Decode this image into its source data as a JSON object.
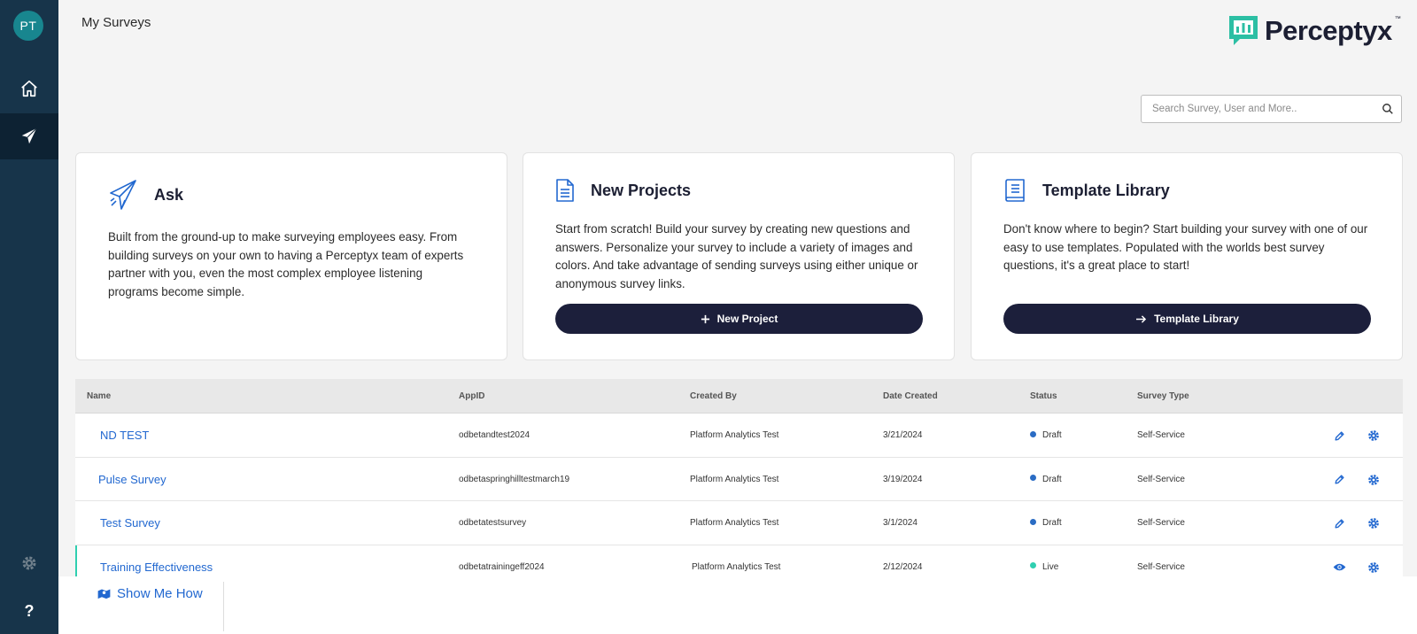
{
  "sidebar": {
    "avatar_initials": "PT",
    "items": [
      {
        "icon": "home-icon"
      },
      {
        "icon": "paper-plane-icon",
        "active": true
      },
      {
        "icon": "gear-icon"
      },
      {
        "icon": "help-icon",
        "label": "?"
      }
    ]
  },
  "header": {
    "title": "My Surveys",
    "logo_text": "Perceptyx",
    "logo_tm": "™"
  },
  "search": {
    "placeholder": "Search Survey, User and More.."
  },
  "cards": {
    "ask": {
      "title": "Ask",
      "body": "Built from the ground-up to make surveying employees easy. From building surveys on your own to having a Perceptyx team of experts partner with you, even the most complex employee listening programs become simple."
    },
    "projects": {
      "title": "New Projects",
      "body": "Start from scratch! Build your survey by creating new questions and answers. Personalize your survey to include a variety of images and colors. And take advantage of sending surveys using either unique or anonymous survey links.",
      "button": "New Project"
    },
    "template": {
      "title": "Template Library",
      "body": "Don't know where to begin? Start building your survey with one of our easy to use templates. Populated with the worlds best survey questions, it's a great place to start!",
      "button": "Template Library"
    }
  },
  "table": {
    "columns": {
      "name": "Name",
      "appid": "AppID",
      "created_by": "Created By",
      "date_created": "Date Created",
      "status": "Status",
      "survey_type": "Survey Type"
    },
    "rows": [
      {
        "name": "ND TEST",
        "appid": "odbetandtest2024",
        "created_by": "Platform Analytics Test",
        "date": "3/21/2024",
        "status": "Draft",
        "type": "Self-Service"
      },
      {
        "name": "Pulse Survey",
        "appid": "odbetaspringhilltestmarch19",
        "created_by": "Platform Analytics Test",
        "date": "3/19/2024",
        "status": "Draft",
        "type": "Self-Service"
      },
      {
        "name": "Test Survey",
        "appid": "odbetatestsurvey",
        "created_by": "Platform Analytics Test",
        "date": "3/1/2024",
        "status": "Draft",
        "type": "Self-Service"
      },
      {
        "name": "Training Effectiveness",
        "appid": "odbetatrainingeff2024",
        "created_by": "Platform Analytics Test",
        "date": "2/12/2024",
        "status": "Live",
        "type": "Self-Service"
      }
    ]
  },
  "footer": {
    "show_me_how": "Show Me How"
  },
  "colors": {
    "sidebar": "#17344a",
    "accent_link": "#2268d0",
    "button_dark": "#1c1f3b",
    "draft_dot": "#2a6cc4",
    "live_dot": "#2fcfb0",
    "logo_teal": "#2cbfa4"
  }
}
